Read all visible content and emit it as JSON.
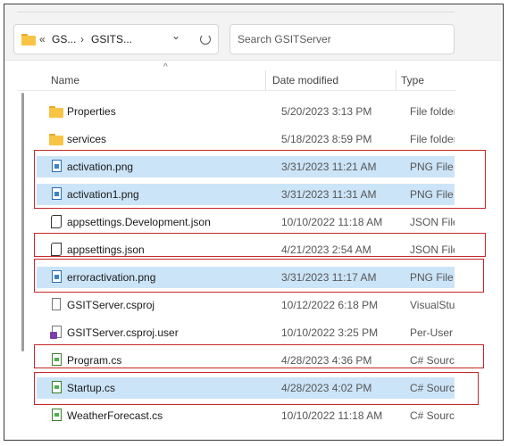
{
  "address": {
    "overflow_chevron": "«",
    "crumb1": "GS...",
    "sep": "›",
    "crumb2": "GSITS...",
    "dropdown": "⌄"
  },
  "search": {
    "placeholder": "Search GSITServer"
  },
  "columns": {
    "name": "Name",
    "date": "Date modified",
    "type": "Type"
  },
  "files": [
    {
      "name": "Properties",
      "date": "5/20/2023 3:13 PM",
      "type": "File folder",
      "icon": "folder-icon",
      "selected": false
    },
    {
      "name": "services",
      "date": "5/18/2023 8:59 PM",
      "type": "File folder",
      "icon": "folder-icon",
      "selected": false
    },
    {
      "name": "activation.png",
      "date": "3/31/2023 11:21 AM",
      "type": "PNG File",
      "icon": "png-file-icon",
      "selected": true
    },
    {
      "name": "activation1.png",
      "date": "3/31/2023 11:31 AM",
      "type": "PNG File",
      "icon": "png-file-icon",
      "selected": true
    },
    {
      "name": "appsettings.Development.json",
      "date": "10/10/2022 11:18 AM",
      "type": "JSON File",
      "icon": "json-file-icon",
      "selected": false
    },
    {
      "name": "appsettings.json",
      "date": "4/21/2023 2:54 AM",
      "type": "JSON File",
      "icon": "json-file-icon",
      "selected": false
    },
    {
      "name": "erroractivation.png",
      "date": "3/31/2023 11:17 AM",
      "type": "PNG File",
      "icon": "png-file-icon",
      "selected": true
    },
    {
      "name": "GSITServer.csproj",
      "date": "10/12/2022 6:18 PM",
      "type": "VisualStudio",
      "icon": "csproj-file-icon",
      "selected": false
    },
    {
      "name": "GSITServer.csproj.user",
      "date": "10/10/2022 3:25 PM",
      "type": "Per-User",
      "icon": "csproj-user-file-icon",
      "selected": false
    },
    {
      "name": "Program.cs",
      "date": "4/28/2023 4:36 PM",
      "type": "C# Source",
      "icon": "csharp-file-icon",
      "selected": false
    },
    {
      "name": "Startup.cs",
      "date": "4/28/2023 4:02 PM",
      "type": "C# Source",
      "icon": "csharp-file-icon",
      "selected": true
    },
    {
      "name": "WeatherForecast.cs",
      "date": "10/10/2022 11:18 AM",
      "type": "C# Source",
      "icon": "csharp-file-icon",
      "selected": false
    }
  ],
  "colors": {
    "selection": "#cce4f7",
    "highlight_box": "#c62828",
    "folder": "#f8c443"
  }
}
